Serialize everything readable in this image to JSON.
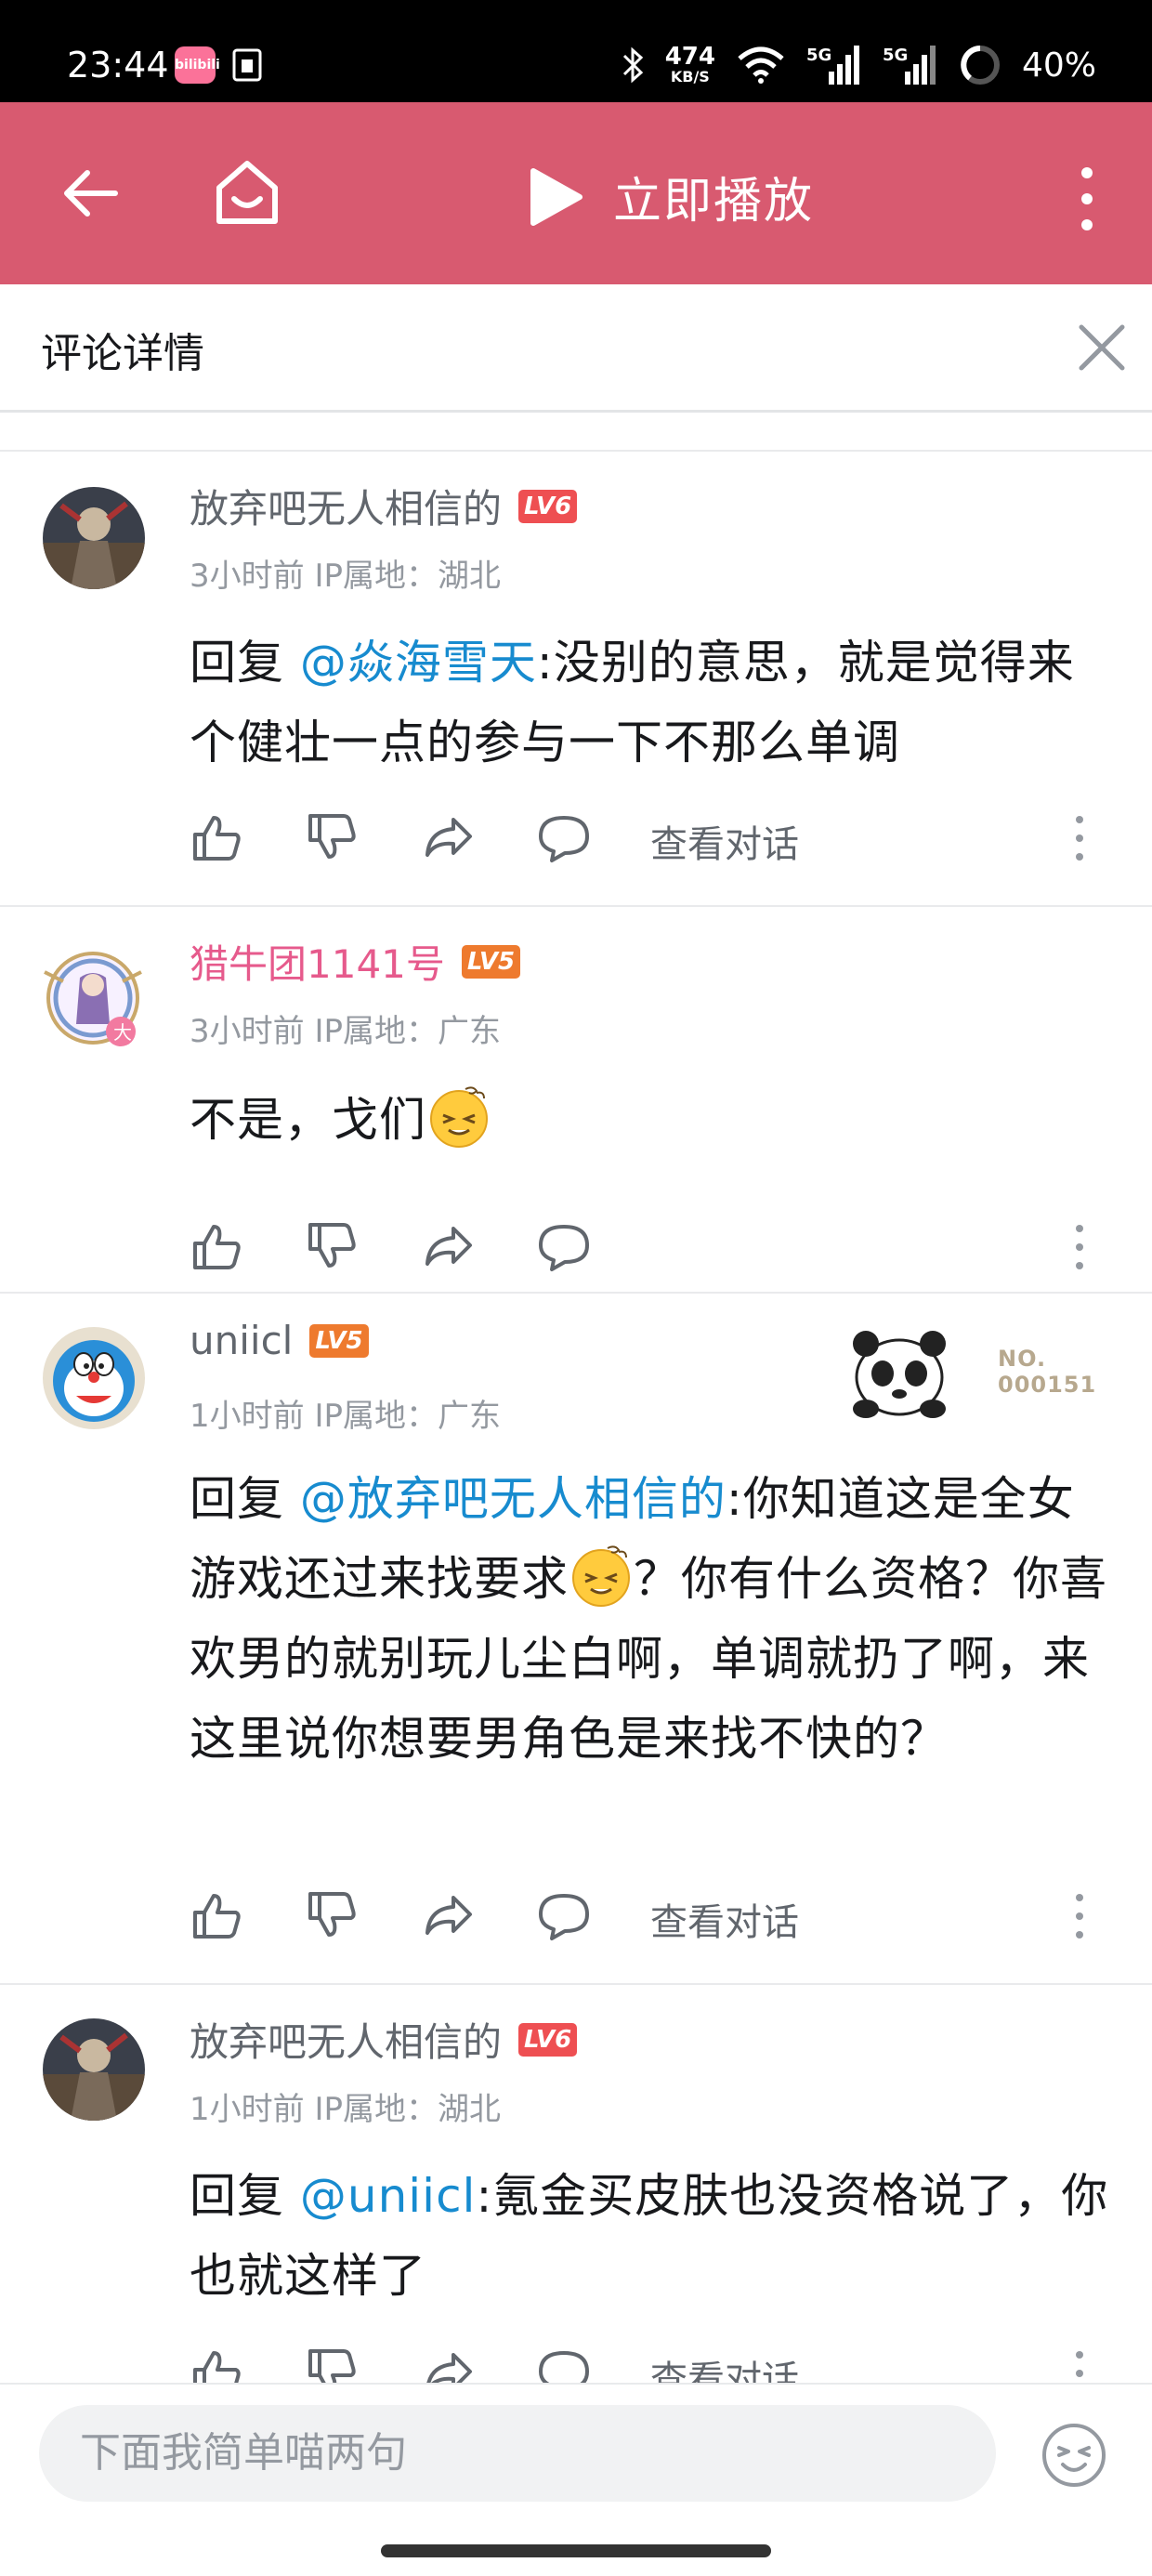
{
  "status_bar": {
    "time": "23:44",
    "app_icon_text": "bilibili",
    "net_speed_value": "474",
    "net_speed_unit": "KB/S",
    "signal_1": "5G",
    "signal_2": "5G",
    "battery": "40%"
  },
  "header": {
    "back_icon": "back-arrow-icon",
    "home_icon": "home-icon",
    "play_title": "立即播放",
    "more_icon": "more-vertical-icon",
    "bg_color": "#d85a70"
  },
  "panel": {
    "title": "评论详情",
    "close_icon": "close-icon"
  },
  "comments": [
    {
      "username": "放弃吧无人相信的",
      "level": "LV6",
      "meta": "3小时前 IP属地：湖北",
      "reply_prefix": "回复 ",
      "mention": "@焱海雪天",
      "text_after_mention": ":没别的意思，就是觉得来个健壮一点的参与一下不那么单调",
      "view_conversation": "查看对话"
    },
    {
      "username": "猎牛团1141号",
      "level": "LV5",
      "meta": "3小时前 IP属地：广东",
      "text": "不是，戈们",
      "emoji": "dizzy-face-emoji"
    },
    {
      "username": "uniicl",
      "level": "LV5",
      "meta": "1小时前 IP属地：广东",
      "fan_badge_no": "NO.\n000151",
      "reply_prefix": "回复 ",
      "mention": "@放弃吧无人相信的",
      "text_part1": ":你知道这是全女游戏还过来找要求",
      "text_part2": "？你有什么资格？你喜欢男的就别玩儿尘白啊，单调就扔了啊，来这里说你想要男角色是来找不快的？",
      "view_conversation": "查看对话"
    },
    {
      "username": "放弃吧无人相信的",
      "level": "LV6",
      "meta": "1小时前 IP属地：湖北",
      "reply_prefix": "回复 ",
      "mention": "@uniicl",
      "text_after_mention": ":氪金买皮肤也没资格说了，你也就这样了",
      "view_conversation": "查看对话"
    }
  ],
  "actions": {
    "like_icon": "thumbs-up-icon",
    "dislike_icon": "thumbs-down-icon",
    "share_icon": "share-icon",
    "reply_icon": "comment-icon",
    "more_icon": "more-vertical-icon"
  },
  "bottom": {
    "placeholder": "下面我简单喵两句",
    "emoji_icon": "emoji-face-icon"
  },
  "colors": {
    "accent_pink": "#d85a70",
    "mention_blue": "#178bcf",
    "lv6_red": "#ee4f52",
    "lv5_orange": "#ee7a2e"
  }
}
